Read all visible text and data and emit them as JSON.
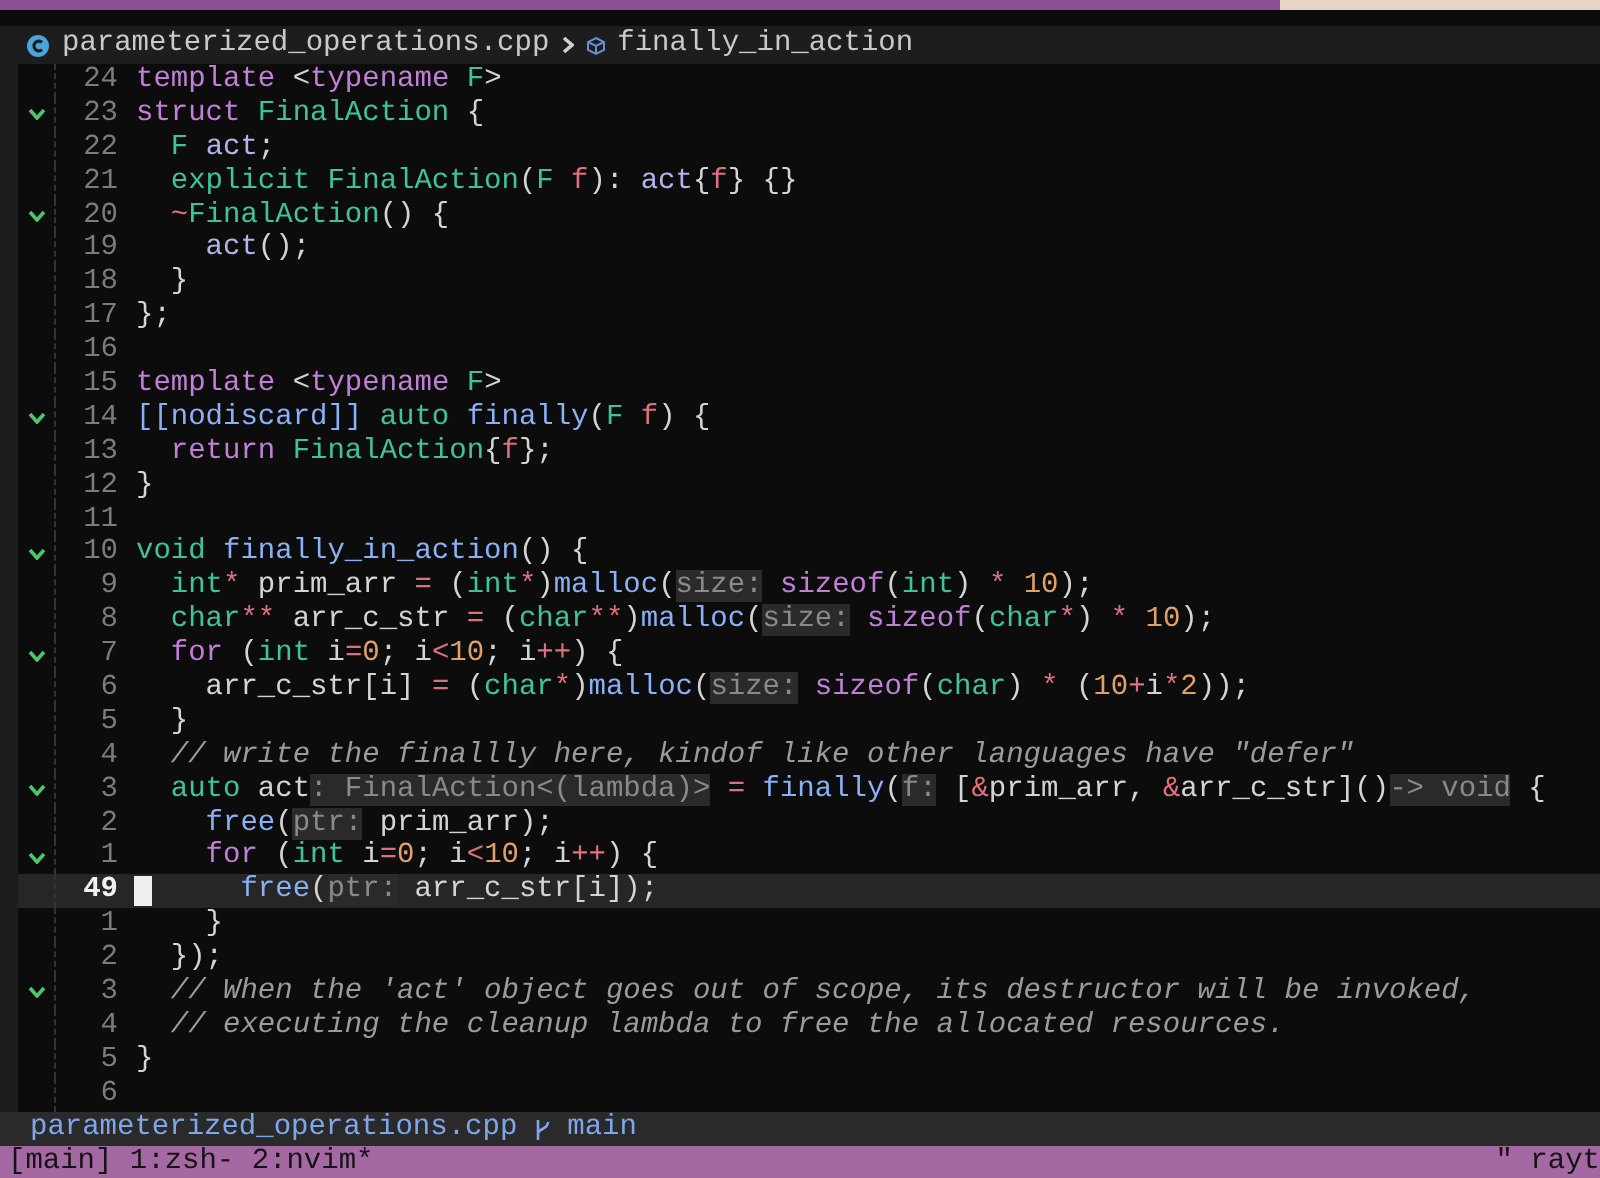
{
  "breadcrumb": {
    "file": "parameterized_operations.cpp",
    "symbol": "finally_in_action"
  },
  "lines": [
    {
      "number": "24",
      "fold": false,
      "current": false,
      "tokens": [
        {
          "kind": "kw",
          "text": "template"
        },
        {
          "kind": "plain",
          "text": " <"
        },
        {
          "kind": "kw",
          "text": "typename "
        },
        {
          "kind": "type",
          "text": "F"
        },
        {
          "kind": "plain",
          "text": ">"
        }
      ]
    },
    {
      "number": "23",
      "fold": true,
      "current": false,
      "tokens": [
        {
          "kind": "kw",
          "text": "struct "
        },
        {
          "kind": "type",
          "text": "FinalAction"
        },
        {
          "kind": "plain",
          "text": " {"
        }
      ]
    },
    {
      "number": "22",
      "fold": false,
      "current": false,
      "tokens": [
        {
          "kind": "type",
          "text": "  F "
        },
        {
          "kind": "var",
          "text": "act"
        },
        {
          "kind": "plain",
          "text": ";"
        }
      ]
    },
    {
      "number": "21",
      "fold": false,
      "current": false,
      "tokens": [
        {
          "kind": "type",
          "text": "  explicit FinalAction"
        },
        {
          "kind": "plain",
          "text": "("
        },
        {
          "kind": "type",
          "text": "F "
        },
        {
          "kind": "param",
          "text": "f"
        },
        {
          "kind": "plain",
          "text": "): "
        },
        {
          "kind": "var",
          "text": "act"
        },
        {
          "kind": "plain",
          "text": "{"
        },
        {
          "kind": "param",
          "text": "f"
        },
        {
          "kind": "plain",
          "text": "} {}"
        }
      ]
    },
    {
      "number": "20",
      "fold": true,
      "current": false,
      "tokens": [
        {
          "kind": "op",
          "text": "  ~"
        },
        {
          "kind": "type",
          "text": "FinalAction"
        },
        {
          "kind": "plain",
          "text": "() {"
        }
      ]
    },
    {
      "number": "19",
      "fold": false,
      "current": false,
      "tokens": [
        {
          "kind": "var",
          "text": "    act"
        },
        {
          "kind": "plain",
          "text": "();"
        }
      ]
    },
    {
      "number": "18",
      "fold": false,
      "current": false,
      "tokens": [
        {
          "kind": "plain",
          "text": "  }"
        }
      ]
    },
    {
      "number": "17",
      "fold": false,
      "current": false,
      "tokens": [
        {
          "kind": "plain",
          "text": "};"
        }
      ]
    },
    {
      "number": "16",
      "fold": false,
      "current": false
    },
    {
      "number": "15",
      "fold": false,
      "current": false,
      "tokens": [
        {
          "kind": "kw",
          "text": "template"
        },
        {
          "kind": "plain",
          "text": " <"
        },
        {
          "kind": "kw",
          "text": "typename "
        },
        {
          "kind": "type",
          "text": "F"
        },
        {
          "kind": "plain",
          "text": ">"
        }
      ]
    },
    {
      "number": "14",
      "fold": true,
      "current": false,
      "tokens": [
        {
          "kind": "fn",
          "text": "[[nodiscard]] "
        },
        {
          "kind": "type",
          "text": "auto "
        },
        {
          "kind": "fn",
          "text": "finally"
        },
        {
          "kind": "plain",
          "text": "("
        },
        {
          "kind": "type",
          "text": "F "
        },
        {
          "kind": "param",
          "text": "f"
        },
        {
          "kind": "plain",
          "text": ") {"
        }
      ]
    },
    {
      "number": "13",
      "fold": false,
      "current": false,
      "tokens": [
        {
          "kind": "kw",
          "text": "  return "
        },
        {
          "kind": "type",
          "text": "FinalAction"
        },
        {
          "kind": "plain",
          "text": "{"
        },
        {
          "kind": "param",
          "text": "f"
        },
        {
          "kind": "plain",
          "text": "};"
        }
      ]
    },
    {
      "number": "12",
      "fold": false,
      "current": false,
      "tokens": [
        {
          "kind": "plain",
          "text": "}"
        }
      ]
    },
    {
      "number": "11",
      "fold": false,
      "current": false
    },
    {
      "number": "10",
      "fold": true,
      "current": false,
      "tokens": [
        {
          "kind": "type",
          "text": "void "
        },
        {
          "kind": "fn",
          "text": "finally_in_action"
        },
        {
          "kind": "plain",
          "text": "() {"
        }
      ]
    },
    {
      "number": "9",
      "fold": false,
      "current": false,
      "tokens": [
        {
          "kind": "type",
          "text": "  int"
        },
        {
          "kind": "op",
          "text": "*"
        },
        {
          "kind": "plain",
          "text": " prim_arr "
        },
        {
          "kind": "op",
          "text": "="
        },
        {
          "kind": "plain",
          "text": " ("
        },
        {
          "kind": "type",
          "text": "int"
        },
        {
          "kind": "op",
          "text": "*"
        },
        {
          "kind": "plain",
          "text": ")"
        },
        {
          "kind": "fn",
          "text": "malloc"
        },
        {
          "kind": "plain",
          "text": "("
        },
        {
          "kind": "hint",
          "text": "size:"
        },
        {
          "kind": "kw",
          "text": " sizeof"
        },
        {
          "kind": "plain",
          "text": "("
        },
        {
          "kind": "type",
          "text": "int"
        },
        {
          "kind": "plain",
          "text": ") "
        },
        {
          "kind": "op",
          "text": "*"
        },
        {
          "kind": "num",
          "text": " 10"
        },
        {
          "kind": "plain",
          "text": ");"
        }
      ]
    },
    {
      "number": "8",
      "fold": false,
      "current": false,
      "tokens": [
        {
          "kind": "type",
          "text": "  char"
        },
        {
          "kind": "op",
          "text": "**"
        },
        {
          "kind": "plain",
          "text": " arr_c_str "
        },
        {
          "kind": "op",
          "text": "="
        },
        {
          "kind": "plain",
          "text": " ("
        },
        {
          "kind": "type",
          "text": "char"
        },
        {
          "kind": "op",
          "text": "**"
        },
        {
          "kind": "plain",
          "text": ")"
        },
        {
          "kind": "fn",
          "text": "malloc"
        },
        {
          "kind": "plain",
          "text": "("
        },
        {
          "kind": "hint",
          "text": "size:"
        },
        {
          "kind": "kw",
          "text": " sizeof"
        },
        {
          "kind": "plain",
          "text": "("
        },
        {
          "kind": "type",
          "text": "char"
        },
        {
          "kind": "op",
          "text": "*"
        },
        {
          "kind": "plain",
          "text": ") "
        },
        {
          "kind": "op",
          "text": "*"
        },
        {
          "kind": "num",
          "text": " 10"
        },
        {
          "kind": "plain",
          "text": ");"
        }
      ]
    },
    {
      "number": "7",
      "fold": true,
      "current": false,
      "tokens": [
        {
          "kind": "kw",
          "text": "  for"
        },
        {
          "kind": "plain",
          "text": " ("
        },
        {
          "kind": "type",
          "text": "int"
        },
        {
          "kind": "plain",
          "text": " i"
        },
        {
          "kind": "op",
          "text": "="
        },
        {
          "kind": "num",
          "text": "0"
        },
        {
          "kind": "plain",
          "text": "; i"
        },
        {
          "kind": "op",
          "text": "<"
        },
        {
          "kind": "num",
          "text": "10"
        },
        {
          "kind": "plain",
          "text": "; i"
        },
        {
          "kind": "op",
          "text": "++"
        },
        {
          "kind": "plain",
          "text": ") {"
        }
      ]
    },
    {
      "number": "6",
      "fold": false,
      "current": false,
      "tokens": [
        {
          "kind": "plain",
          "text": "    arr_c_str[i] "
        },
        {
          "kind": "op",
          "text": "="
        },
        {
          "kind": "plain",
          "text": " ("
        },
        {
          "kind": "type",
          "text": "char"
        },
        {
          "kind": "op",
          "text": "*"
        },
        {
          "kind": "plain",
          "text": ")"
        },
        {
          "kind": "fn",
          "text": "malloc"
        },
        {
          "kind": "plain",
          "text": "("
        },
        {
          "kind": "hint",
          "text": "size:"
        },
        {
          "kind": "kw",
          "text": " sizeof"
        },
        {
          "kind": "plain",
          "text": "("
        },
        {
          "kind": "type",
          "text": "char"
        },
        {
          "kind": "plain",
          "text": ") "
        },
        {
          "kind": "op",
          "text": "*"
        },
        {
          "kind": "plain",
          "text": " ("
        },
        {
          "kind": "num",
          "text": "10"
        },
        {
          "kind": "op",
          "text": "+"
        },
        {
          "kind": "plain",
          "text": "i"
        },
        {
          "kind": "op",
          "text": "*"
        },
        {
          "kind": "num",
          "text": "2"
        },
        {
          "kind": "plain",
          "text": "));"
        }
      ]
    },
    {
      "number": "5",
      "fold": false,
      "current": false,
      "tokens": [
        {
          "kind": "plain",
          "text": "  }"
        }
      ]
    },
    {
      "number": "4",
      "fold": false,
      "current": false,
      "tokens": [
        {
          "kind": "comment",
          "text": "  // write the finallly here, kindof like other languages have \"defer\""
        }
      ]
    },
    {
      "number": "3",
      "fold": true,
      "current": false,
      "tokens": [
        {
          "kind": "type",
          "text": "  auto"
        },
        {
          "kind": "plain",
          "text": " act"
        },
        {
          "kind": "hint",
          "text": ": FinalAction<(lambda)>"
        },
        {
          "kind": "op",
          "text": " ="
        },
        {
          "kind": "fn",
          "text": " finally"
        },
        {
          "kind": "plain",
          "text": "("
        },
        {
          "kind": "hint",
          "text": "f:"
        },
        {
          "kind": "plain",
          "text": " ["
        },
        {
          "kind": "op",
          "text": "&"
        },
        {
          "kind": "plain",
          "text": "prim_arr, "
        },
        {
          "kind": "op",
          "text": "&"
        },
        {
          "kind": "plain",
          "text": "arr_c_str]()"
        },
        {
          "kind": "hint",
          "text": "-> void"
        },
        {
          "kind": "plain",
          "text": " {"
        }
      ]
    },
    {
      "number": "2",
      "fold": false,
      "current": false,
      "tokens": [
        {
          "kind": "fn",
          "text": "    free"
        },
        {
          "kind": "plain",
          "text": "("
        },
        {
          "kind": "hint",
          "text": "ptr:"
        },
        {
          "kind": "plain",
          "text": " prim_arr);"
        }
      ]
    },
    {
      "number": "1",
      "fold": true,
      "current": false,
      "tokens": [
        {
          "kind": "kw",
          "text": "    for"
        },
        {
          "kind": "plain",
          "text": " ("
        },
        {
          "kind": "type",
          "text": "int"
        },
        {
          "kind": "plain",
          "text": " i"
        },
        {
          "kind": "op",
          "text": "="
        },
        {
          "kind": "num",
          "text": "0"
        },
        {
          "kind": "plain",
          "text": "; i"
        },
        {
          "kind": "op",
          "text": "<"
        },
        {
          "kind": "num",
          "text": "10"
        },
        {
          "kind": "plain",
          "text": "; i"
        },
        {
          "kind": "op",
          "text": "++"
        },
        {
          "kind": "plain",
          "text": ") {"
        }
      ]
    },
    {
      "number": "49",
      "fold": false,
      "current": true,
      "tokens": [
        {
          "kind": "fn",
          "text": "      free"
        },
        {
          "kind": "plain",
          "text": "("
        },
        {
          "kind": "hint",
          "text": "ptr:"
        },
        {
          "kind": "plain",
          "text": " arr_c_str[i]);"
        }
      ]
    },
    {
      "number": "1",
      "fold": false,
      "current": false,
      "tokens": [
        {
          "kind": "plain",
          "text": "    }"
        }
      ]
    },
    {
      "number": "2",
      "fold": false,
      "current": false,
      "tokens": [
        {
          "kind": "plain",
          "text": "  });"
        }
      ]
    },
    {
      "number": "3",
      "fold": true,
      "current": false,
      "tokens": [
        {
          "kind": "comment",
          "text": "  // When the 'act' object goes out of scope, its destructor will be invoked,"
        }
      ]
    },
    {
      "number": "4",
      "fold": false,
      "current": false,
      "tokens": [
        {
          "kind": "comment",
          "text": "  // executing the cleanup lambda to free the allocated resources."
        }
      ]
    },
    {
      "number": "5",
      "fold": false,
      "current": false,
      "tokens": [
        {
          "kind": "plain",
          "text": "}"
        }
      ]
    },
    {
      "number": "6",
      "fold": false,
      "current": false
    }
  ],
  "status_line": {
    "file": "parameterized_operations.cpp",
    "branch": "main"
  },
  "tmux_bar": {
    "left": "[main] 1:zsh- 2:nvim*",
    "right": "\" rayt"
  }
}
